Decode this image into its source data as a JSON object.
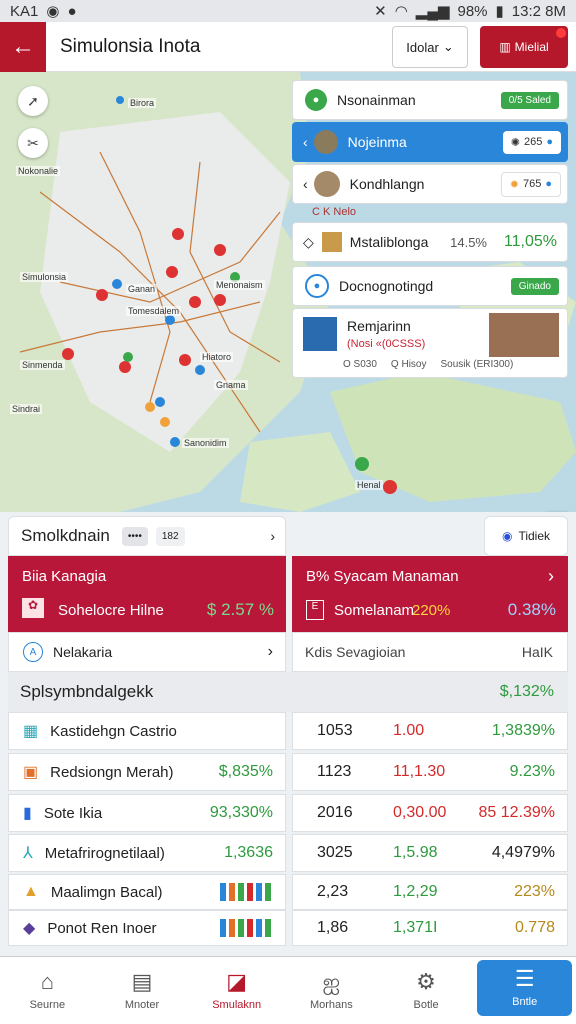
{
  "status": {
    "carrier": "KA1",
    "battery": "98%",
    "time": "13:2 8M"
  },
  "appbar": {
    "title": "Simulonsia Inota",
    "mode_label": "Idolar",
    "menu_label": "Mielial"
  },
  "map": {
    "labels": [
      "Simulonsia",
      "Birora",
      "Nokonalie",
      "Ganan",
      "Menonaism",
      "Tomesdalem",
      "Hiatoro",
      "Sinmenda",
      "Sanonidim",
      "Gnama",
      "Sindrai",
      "Henal"
    ],
    "overlay": {
      "row1": {
        "title": "Nsonainman",
        "badge": "0/5 Saled"
      },
      "row2": {
        "title": "Nojeinma",
        "value": "265"
      },
      "row3": {
        "title": "Kondhlangn",
        "value": "765"
      },
      "row3b": {
        "title": "C K Nelo"
      },
      "row4": {
        "title": "Mstaliblonga",
        "value": "14.5%",
        "value2": "11,05%"
      },
      "row5": {
        "title": "Docnognotingd",
        "badge": "Ginado"
      },
      "row6": {
        "title": "Remjarinn",
        "sub": "(Nosi «(0CSSS)",
        "note1": "O S030",
        "note2": "Q Hisoy",
        "note3": "Sousik (ERI300)"
      }
    }
  },
  "section": {
    "title": "Smolkdnain",
    "btn1": "••••",
    "btn2": "182",
    "right_tab": "Tidiek",
    "red_left": {
      "title": "Biia Kanagia",
      "label": "Sohelocre Hilne",
      "value": "$ 2.57 %"
    },
    "red_right": {
      "title": "B% Syacam Manaman",
      "label": "Somelanam",
      "value1": "220%",
      "value2": "0.38%"
    },
    "nav_left": "Nelakaria",
    "nav_right": "Kdis Sevagioian",
    "nav_right_end": "HaIK",
    "subtitle": "Splsymbndalgekk",
    "subtitle_value": "$,132%"
  },
  "rows": [
    {
      "label": "Kastidehgn Castrio",
      "left_val": "",
      "c1": "1053",
      "c2": "1.00",
      "c3": "1,3839%",
      "c2_color": "red",
      "c3_color": "green",
      "icon": "grid-icon"
    },
    {
      "label": "Redsiongn Merah)",
      "left_val": "$,835%",
      "c1": "1123",
      "c2": "11,1.30",
      "c3": "9.23%",
      "c2_color": "red",
      "c3_color": "green",
      "icon": "box-icon"
    },
    {
      "label": "Sote Ikia",
      "left_val": "93,330%",
      "c1": "2016",
      "c2": "0,30.00",
      "c3": "85 12.39%",
      "c2_color": "red",
      "c3_color": "red",
      "icon": "trash-icon"
    },
    {
      "label": "Metafrirognetilaal)",
      "left_val": "1,3636",
      "c1": "3025",
      "c2": "1,5.98",
      "c3": "4,4979%",
      "c2_color": "green",
      "c3_color": "dark",
      "icon": "chart-icon"
    },
    {
      "label": "Maalimgn Bacal)",
      "left_val": "",
      "c1": "2,23",
      "c2": "1,2,29",
      "c3": "223%",
      "c2_color": "green",
      "c3_color": "olive",
      "icon": "warning-icon"
    },
    {
      "label": "Ponot Ren Inoer",
      "left_val": "",
      "c1": "1,86",
      "c2": "1,371I",
      "c3": "0.778",
      "c2_color": "green",
      "c3_color": "olive",
      "icon": "cube-icon"
    }
  ],
  "tabs": [
    {
      "label": "Seurne",
      "icon": "home-icon"
    },
    {
      "label": "Mnoter",
      "icon": "list-icon"
    },
    {
      "label": "Smulaknn",
      "icon": "sim-icon"
    },
    {
      "label": "Morhans",
      "icon": "people-icon"
    },
    {
      "label": "Botle",
      "icon": "gear-icon"
    },
    {
      "label": "Bntle",
      "icon": "menu-icon"
    }
  ],
  "colors": {
    "brand_red": "#b5172b",
    "accent_blue": "#2a86d9",
    "green": "#3aa84a"
  }
}
